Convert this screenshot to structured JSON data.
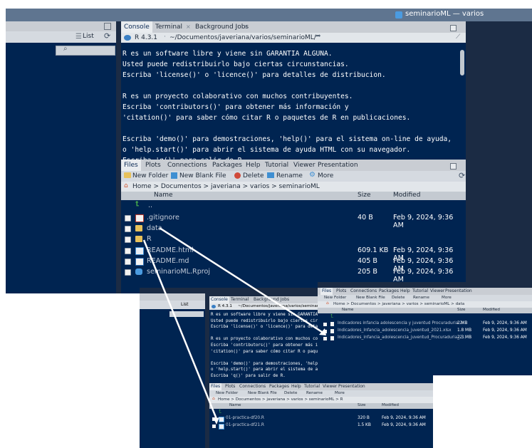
{
  "main": {
    "titlebar": "seminarioML — varios",
    "left_pane": {
      "list_label": "List"
    },
    "console": {
      "tabs": [
        "Console",
        "Terminal",
        "Background Jobs"
      ],
      "r_version": "R 4.3.1",
      "path": "~/Documentos/javeriana/varios/seminarioML/",
      "lines": [
        "R es un software libre y viene sin GARANTIA ALGUNA.",
        "Usted puede redistribuirlo bajo ciertas circunstancias.",
        "Escriba 'license()' o 'licence()' para detalles de distribucion.",
        "",
        "R es un proyecto colaborativo con muchos contribuyentes.",
        "Escriba 'contributors()' para obtener más información y",
        "'citation()' para saber cómo citar R o paquetes de R en publicaciones.",
        "",
        "Escriba 'demo()' para demostraciones, 'help()' para el sistema on-line de ayuda,",
        "o 'help.start()' para abrir el sistema de ayuda HTML con su navegador.",
        "Escriba 'q()' para salir de R.",
        "",
        ""
      ],
      "prompt": ">"
    },
    "files": {
      "tabs": [
        "Files",
        "Plots",
        "Connections",
        "Packages",
        "Help",
        "Tutorial",
        "Viewer",
        "Presentation"
      ],
      "toolbar": {
        "new_folder": "New Folder",
        "new_blank_file": "New Blank File",
        "delete": "Delete",
        "rename": "Rename",
        "more": "More"
      },
      "breadcrumb": [
        "Home",
        "Documentos",
        "javeriana",
        "varios",
        "seminarioML"
      ],
      "columns": {
        "name": "Name",
        "size": "Size",
        "modified": "Modified"
      },
      "up": "..",
      "rows": [
        {
          "name": ".gitignore",
          "size": "40 B",
          "modified": "Feb 9, 2024, 9:36 AM",
          "icon": "file-icon"
        },
        {
          "name": "data",
          "size": "",
          "modified": "",
          "icon": "folder-icon"
        },
        {
          "name": "R",
          "size": "",
          "modified": "",
          "icon": "folder-icon"
        },
        {
          "name": "README.html",
          "size": "609.1 KB",
          "modified": "Feb 9, 2024, 9:36 AM",
          "icon": "html-file-icon"
        },
        {
          "name": "README.md",
          "size": "405 B",
          "modified": "Feb 9, 2024, 9:36 AM",
          "icon": "markdown-file-icon"
        },
        {
          "name": "seminarioML.Rproj",
          "size": "205 B",
          "modified": "Feb 9, 2024, 9:36 AM",
          "icon": "rproj-icon"
        }
      ]
    }
  },
  "zoom_r": {
    "console_tabs": [
      "Console",
      "Terminal",
      "Background Jobs"
    ],
    "r_version": "R 4.3.1",
    "path": "~/Documentos/javeriana/varios/seminarioML/",
    "list_label": "List",
    "lines": [
      "R es un software libre y viene sin GARANTIA ALGUNA.",
      "Usted puede redistribuirlo bajo ciertas circunstancias.",
      "Escriba 'license()' o 'licence()' para detalles de distribucion.",
      "",
      "R es un proyecto colaborativo con muchos contribuyentes.",
      "Escriba 'contributors()' para obtener más información y",
      "'citation()' para saber cómo citar R o paquetes de R en publicaciones.",
      "",
      "Escriba 'demo()' para demostraciones, 'help()' para el sistema on-line de ayuda,",
      "o 'help.start()' para abrir el sistema de ayuda HTML con su navegador.",
      "Escriba 'q()' para salir de R.",
      "",
      ""
    ],
    "prompt": ">",
    "files_tabs": [
      "Files",
      "Plots",
      "Connections",
      "Packages",
      "Help",
      "Tutorial",
      "Viewer",
      "Presentation"
    ],
    "toolbar": {
      "new_folder": "New Folder",
      "new_blank_file": "New Blank File",
      "delete": "Delete",
      "rename": "Rename",
      "more": "More"
    },
    "breadcrumb": [
      "Home",
      "Documentos",
      "javeriana",
      "varios",
      "seminarioML",
      "R"
    ],
    "columns": {
      "name": "Name",
      "size": "Size",
      "modified": "Modified"
    },
    "rows": [
      {
        "name": "01-practica-df20.R",
        "size": "320 B",
        "modified": "Feb 9, 2024, 9:36 AM"
      },
      {
        "name": "01-practica-df21.R",
        "size": "1.5 KB",
        "modified": "Feb 9, 2024, 9:36 AM"
      }
    ]
  },
  "zoom_data": {
    "files_tabs": [
      "Files",
      "Plots",
      "Connections",
      "Packages",
      "Help",
      "Tutorial",
      "Viewer",
      "Presentation"
    ],
    "toolbar": {
      "new_folder": "New Folder",
      "new_blank_file": "New Blank File",
      "delete": "Delete",
      "rename": "Rename",
      "more": "More"
    },
    "breadcrumb": [
      "Home",
      "Documentos",
      "javeriana",
      "varios",
      "seminarioML",
      "data"
    ],
    "columns": {
      "name": "Name",
      "size": "Size",
      "modified": "Modified"
    },
    "rows": [
      {
        "name": "Indicadores infancia adolescencia y juventud Procuraduria 2...",
        "size": "2 MB",
        "modified": "Feb 9, 2024, 9:36 AM"
      },
      {
        "name": "Indicadores_Infancia_adolescencia_juventud_2021.xlsx",
        "size": "1.8 MB",
        "modified": "Feb 9, 2024, 9:36 AM"
      },
      {
        "name": "Indicadores_infancia_adolescencia_juventud_Procuraduria_2...",
        "size": "2.3 MB",
        "modified": "Feb 9, 2024, 9:36 AM"
      }
    ]
  },
  "colors": {
    "navy": "#002451",
    "accent": "#3f8fd2",
    "folder": "#e8c15a"
  }
}
